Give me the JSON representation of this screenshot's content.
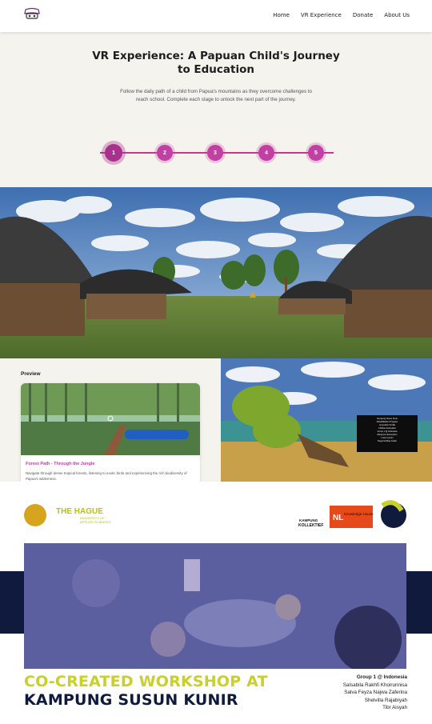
{
  "nav": {
    "logo_icon": "vr-headset-logo",
    "links": [
      "Home",
      "VR Experience",
      "Donate",
      "About Us"
    ]
  },
  "hero": {
    "title": "VR Experience: A Papuan Child's Journey to Education",
    "description": "Follow the daily path of a child from Papua's mountains as they overcome challenges to reach school. Complete each stage to unlock the next part of the journey.",
    "steps": [
      "1",
      "2",
      "3",
      "4",
      "5"
    ],
    "active_step": "1",
    "accent_color": "#c23fa4"
  },
  "preview": {
    "heading": "Preview",
    "card_title": "Forest Path - Through the Jungle",
    "card_description": "Navigate through dense tropical forests, listening to exotic birds and experiencing the rich biodiversity of Papua's wilderness."
  },
  "scene2": {
    "info_lines": [
      "Kampung Susun Kunir",
      "Rehabilitation Program",
      "Innovation Profile",
      "Children Education",
      "Group 1 @ Indonesia",
      "Mangrove Ecosystem",
      "Lorem Ipsum",
      "Regional Map Guide"
    ]
  },
  "poster": {
    "hague_name": "THE HAGUE",
    "hague_sub1": "UNIVERSITY OF",
    "hague_sub2": "APPLIED SCIENCES",
    "kampung_logo": "KAMPUNG",
    "kollektief": "KOLLEKTIEF",
    "nl_logo": "NL",
    "knowledge_house": "Knowledge House",
    "title_line1": "CO-CREATED WORKSHOP AT",
    "title_line2": "KAMPUNG SUSUN KUNIR",
    "group": "Group 1 @ Indonesia",
    "members": [
      "Salsabila Rakhfi Khoirunnisa",
      "Salva Feyza Najwa Zaferina",
      "Shelvilla Rajabiyah",
      "Tibr Aisyah"
    ]
  }
}
